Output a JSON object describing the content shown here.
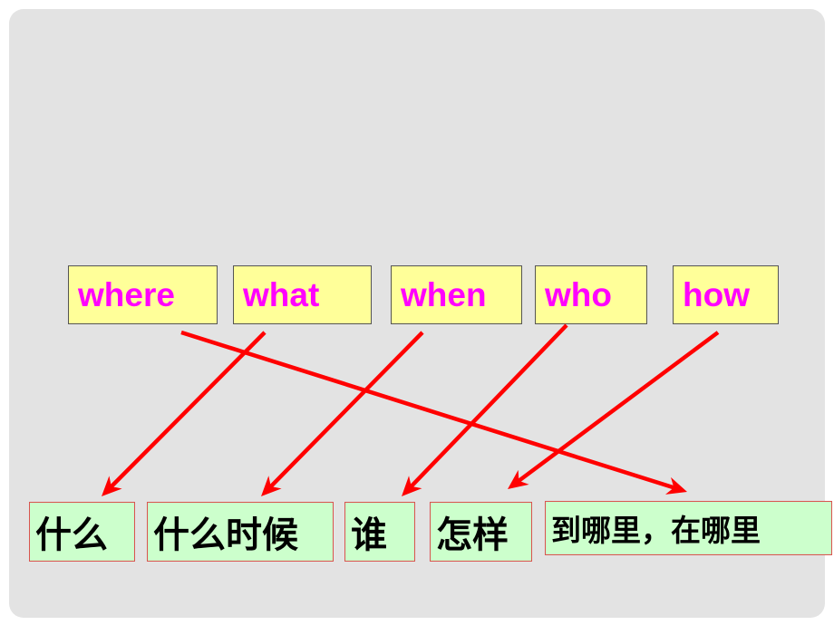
{
  "english_words": [
    {
      "id": "where",
      "label": "where"
    },
    {
      "id": "what",
      "label": "what"
    },
    {
      "id": "when",
      "label": "when"
    },
    {
      "id": "who",
      "label": "who"
    },
    {
      "id": "how",
      "label": "how"
    }
  ],
  "chinese_words": [
    {
      "id": "shenme",
      "label": "什么"
    },
    {
      "id": "shenmeshihou",
      "label": "什么时候"
    },
    {
      "id": "shui",
      "label": "谁"
    },
    {
      "id": "zenyang",
      "label": "怎样"
    },
    {
      "id": "daonali",
      "label": "到哪里，在哪里"
    }
  ],
  "connections": [
    {
      "from": "where",
      "to": "daonali"
    },
    {
      "from": "what",
      "to": "shenme"
    },
    {
      "from": "when",
      "to": "shenmeshihou"
    },
    {
      "from": "who",
      "to": "shui"
    },
    {
      "from": "how",
      "to": "zenyang"
    }
  ],
  "colors": {
    "panel": "#e3e3e3",
    "english_box_fill": "#ffff99",
    "english_text": "#ff00ff",
    "chinese_box_fill": "#ccffcc",
    "chinese_box_border": "#d9534f",
    "arrow": "#ff0000"
  }
}
